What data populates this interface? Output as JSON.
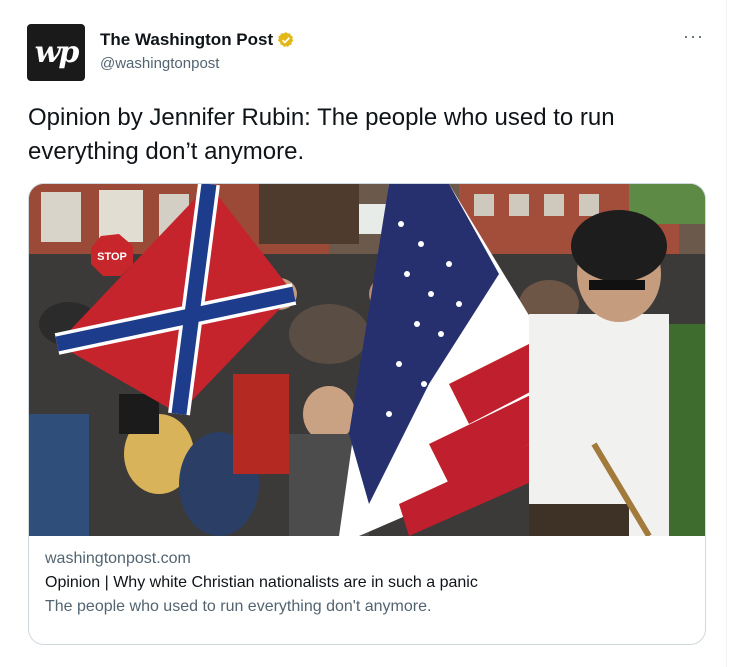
{
  "account": {
    "avatar_text": "wp",
    "name": "The Washington Post",
    "handle": "@washingtonpost"
  },
  "menu": {
    "more_label": "···"
  },
  "tweet": {
    "text": "Opinion by Jennifer Rubin: The people who used to run everything don’t anymore."
  },
  "card": {
    "domain": "washingtonpost.com",
    "title": "Opinion | Why white Christian nationalists are in such a panic",
    "description": "The people who used to run everything don't anymore.",
    "image_sign_text": "STOP"
  },
  "icons": {
    "verified": "verified-badge-icon",
    "more": "more-dots-icon"
  },
  "colors": {
    "badge": "#e2b719",
    "name": "#0f1419",
    "muted": "#536471"
  }
}
